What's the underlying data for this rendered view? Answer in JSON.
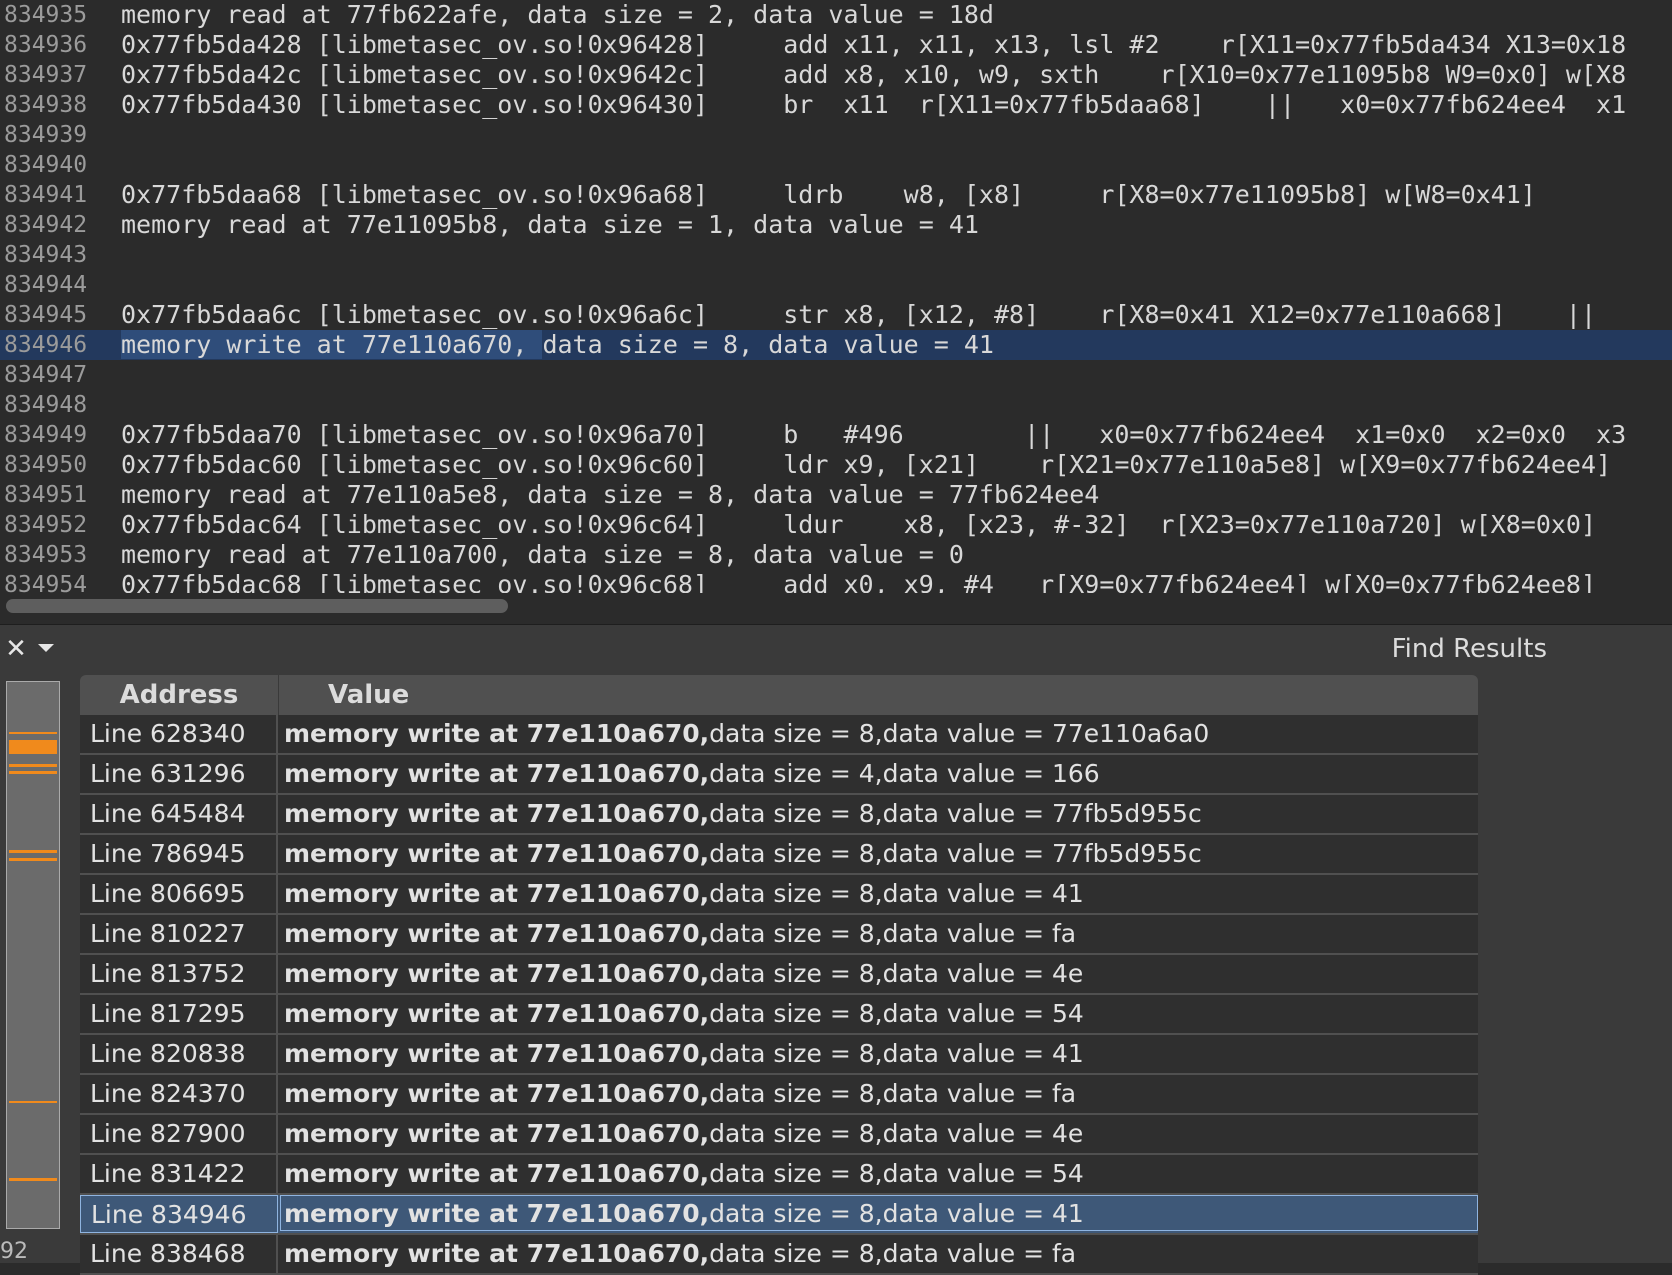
{
  "editor": {
    "lines": [
      {
        "num": "834935",
        "text": "memory read at 77fb622afe, data size = 2, data value = 18d"
      },
      {
        "num": "834936",
        "text": "0x77fb5da428 [libmetasec_ov.so!0x96428]     add x11, x11, x13, lsl #2    r[X11=0x77fb5da434 X13=0x18"
      },
      {
        "num": "834937",
        "text": "0x77fb5da42c [libmetasec_ov.so!0x9642c]     add x8, x10, w9, sxth    r[X10=0x77e11095b8 W9=0x0] w[X8"
      },
      {
        "num": "834938",
        "text": "0x77fb5da430 [libmetasec_ov.so!0x96430]     br  x11  r[X11=0x77fb5daa68]    ||   x0=0x77fb624ee4  x1"
      },
      {
        "num": "834939",
        "text": ""
      },
      {
        "num": "834940",
        "text": ""
      },
      {
        "num": "834941",
        "text": "0x77fb5daa68 [libmetasec_ov.so!0x96a68]     ldrb    w8, [x8]     r[X8=0x77e11095b8] w[W8=0x41]"
      },
      {
        "num": "834942",
        "text": "memory read at 77e11095b8, data size = 1, data value = 41"
      },
      {
        "num": "834943",
        "text": ""
      },
      {
        "num": "834944",
        "text": ""
      },
      {
        "num": "834945",
        "text": "0x77fb5daa6c [libmetasec_ov.so!0x96a6c]     str x8, [x12, #8]    r[X8=0x41 X12=0x77e110a668]    ||"
      },
      {
        "num": "834946",
        "text": "memory write at 77e110a670, data size = 8, data value = 41",
        "selected": true,
        "sel_part": "memory write at 77e110a670, ",
        "rest_part": "data size = 8, data value = 41"
      },
      {
        "num": "834947",
        "text": ""
      },
      {
        "num": "834948",
        "text": ""
      },
      {
        "num": "834949",
        "text": "0x77fb5daa70 [libmetasec_ov.so!0x96a70]     b   #496        ||   x0=0x77fb624ee4  x1=0x0  x2=0x0  x3"
      },
      {
        "num": "834950",
        "text": "0x77fb5dac60 [libmetasec_ov.so!0x96c60]     ldr x9, [x21]    r[X21=0x77e110a5e8] w[X9=0x77fb624ee4]"
      },
      {
        "num": "834951",
        "text": "memory read at 77e110a5e8, data size = 8, data value = 77fb624ee4"
      },
      {
        "num": "834952",
        "text": "0x77fb5dac64 [libmetasec_ov.so!0x96c64]     ldur    x8, [x23, #-32]  r[X23=0x77e110a720] w[X8=0x0]"
      },
      {
        "num": "834953",
        "text": "memory read at 77e110a700, data size = 8, data value = 0"
      },
      {
        "num": "834954",
        "text": "0x77fb5dac68 [libmetasec_ov.so!0x96c68]     add x0, x9, #4   r[X9=0x77fb624ee4] w[X0=0x77fb624ee8]"
      }
    ]
  },
  "panel": {
    "title": "Find Results",
    "close_icon": "close-icon",
    "menu_icon": "chevron-down-icon",
    "columns": {
      "address": "Address",
      "value": "Value"
    },
    "bold_prefix": "memory write at 77e110a670,",
    "rows": [
      {
        "address": "Line 628340",
        "bold": "memory write at 77e110a670,",
        "rest": "data size = 8,data value = 77e110a6a0"
      },
      {
        "address": "Line 631296",
        "bold": "memory write at 77e110a670,",
        "rest": "data size = 4,data value = 166"
      },
      {
        "address": "Line 645484",
        "bold": "memory write at 77e110a670,",
        "rest": "data size = 8,data value = 77fb5d955c"
      },
      {
        "address": "Line 786945",
        "bold": "memory write at 77e110a670,",
        "rest": "data size = 8,data value = 77fb5d955c"
      },
      {
        "address": "Line 806695",
        "bold": "memory write at 77e110a670,",
        "rest": "data size = 8,data value = 41"
      },
      {
        "address": "Line 810227",
        "bold": "memory write at 77e110a670,",
        "rest": "data size = 8,data value = fa"
      },
      {
        "address": "Line 813752",
        "bold": "memory write at 77e110a670,",
        "rest": "data size = 8,data value = 4e"
      },
      {
        "address": "Line 817295",
        "bold": "memory write at 77e110a670,",
        "rest": "data size = 8,data value = 54"
      },
      {
        "address": "Line 820838",
        "bold": "memory write at 77e110a670,",
        "rest": "data size = 8,data value = 41"
      },
      {
        "address": "Line 824370",
        "bold": "memory write at 77e110a670,",
        "rest": "data size = 8,data value = fa"
      },
      {
        "address": "Line 827900",
        "bold": "memory write at 77e110a670,",
        "rest": "data size = 8,data value = 4e"
      },
      {
        "address": "Line 831422",
        "bold": "memory write at 77e110a670,",
        "rest": "data size = 8,data value = 54"
      },
      {
        "address": "Line 834946",
        "bold": "memory write at 77e110a670,",
        "rest": "data size = 8,data value = 41",
        "selected": true
      },
      {
        "address": "Line 838468",
        "bold": "memory write at 77e110a670,",
        "rest": "data size = 8,data value = fa"
      }
    ],
    "bottom_number": "92",
    "colors": {
      "highlight_orange": "#f08a1c",
      "selected_row": "#3e5878",
      "editor_selected": "#23395d"
    }
  }
}
